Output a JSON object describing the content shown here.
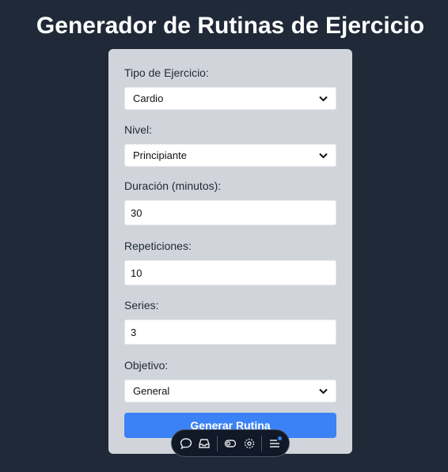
{
  "header": {
    "title": "Generador de Rutinas de Ejercicio"
  },
  "form": {
    "exercise_type": {
      "label": "Tipo de Ejercicio:",
      "value": "Cardio"
    },
    "level": {
      "label": "Nivel:",
      "value": "Principiante"
    },
    "duration": {
      "label": "Duración (minutos):",
      "value": "30"
    },
    "repetitions": {
      "label": "Repeticiones:",
      "value": "10"
    },
    "series": {
      "label": "Series:",
      "value": "3"
    },
    "objective": {
      "label": "Objetivo:",
      "value": "General"
    },
    "submit_label": "Generar Rutina"
  },
  "toolbar": {
    "icons": [
      "comment-icon",
      "inbox-icon",
      "toggle-icon",
      "eye-settings-icon",
      "menu-icon"
    ]
  },
  "colors": {
    "background": "#1f2937",
    "card": "#d1d5db",
    "accent": "#3b82f6"
  }
}
